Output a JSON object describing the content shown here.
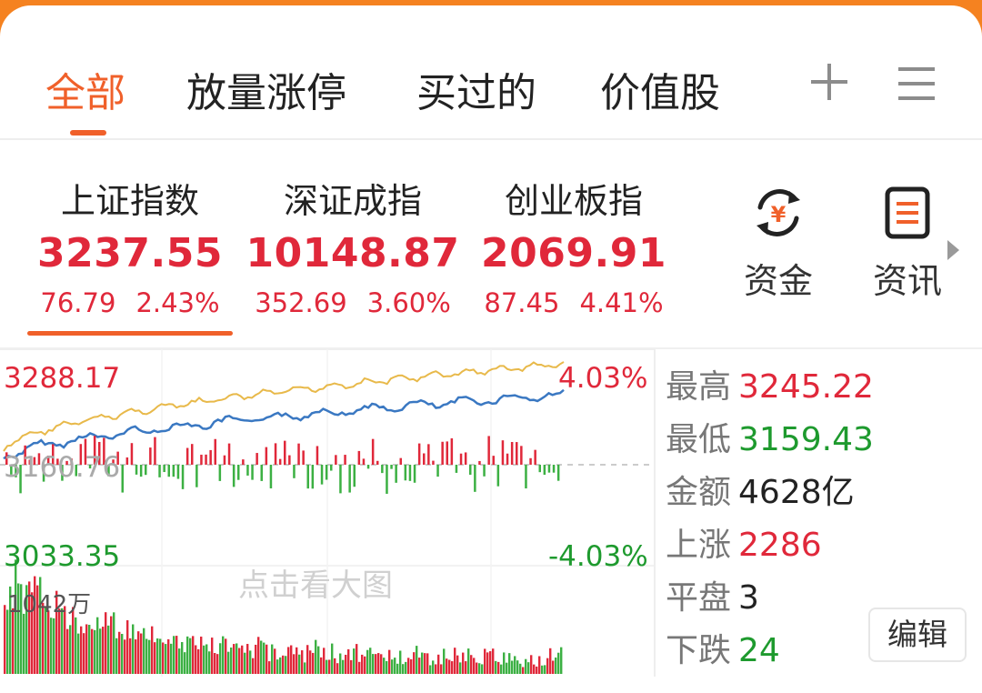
{
  "tabs": [
    {
      "label": "全部",
      "active": true
    },
    {
      "label": "放量涨停"
    },
    {
      "label": "买过的"
    },
    {
      "label": "价值股"
    }
  ],
  "indices": [
    {
      "name": "上证指数",
      "price": "3237.55",
      "change": "76.79",
      "pct": "2.43%"
    },
    {
      "name": "深证成指",
      "price": "10148.87",
      "change": "352.69",
      "pct": "3.60%"
    },
    {
      "name": "创业板指",
      "price": "2069.91",
      "change": "87.45",
      "pct": "4.41%"
    }
  ],
  "quick": [
    {
      "label": "资金",
      "icon": "yuan-exchange-icon"
    },
    {
      "label": "资讯",
      "icon": "news-doc-icon"
    }
  ],
  "chart": {
    "high_label": "3288.17",
    "base_label": "3160.76",
    "low_label": "3033.35",
    "pct_high": "4.03%",
    "pct_low": "-4.03%",
    "volume_label": "1042万",
    "hint": "点击看大图"
  },
  "chart_data": {
    "type": "line",
    "ylim": [
      3033.35,
      3288.17
    ],
    "baseline": 3160.76,
    "series": [],
    "volume_max": 1042
  },
  "stats": [
    {
      "key": "最高",
      "value": "3245.22",
      "color": "red"
    },
    {
      "key": "最低",
      "value": "3159.43",
      "color": "green"
    },
    {
      "key": "金额",
      "value": "4628亿",
      "color": "black"
    },
    {
      "key": "上涨",
      "value": "2286",
      "color": "red"
    },
    {
      "key": "平盘",
      "value": "3",
      "color": "black"
    },
    {
      "key": "下跌",
      "value": "24",
      "color": "green"
    }
  ],
  "edit_label": "编辑",
  "colors": {
    "accent": "#f0602a",
    "up": "#e0283a",
    "down": "#1e9a2e",
    "line_main": "#3a78c2",
    "line_avg": "#e8b94a"
  }
}
